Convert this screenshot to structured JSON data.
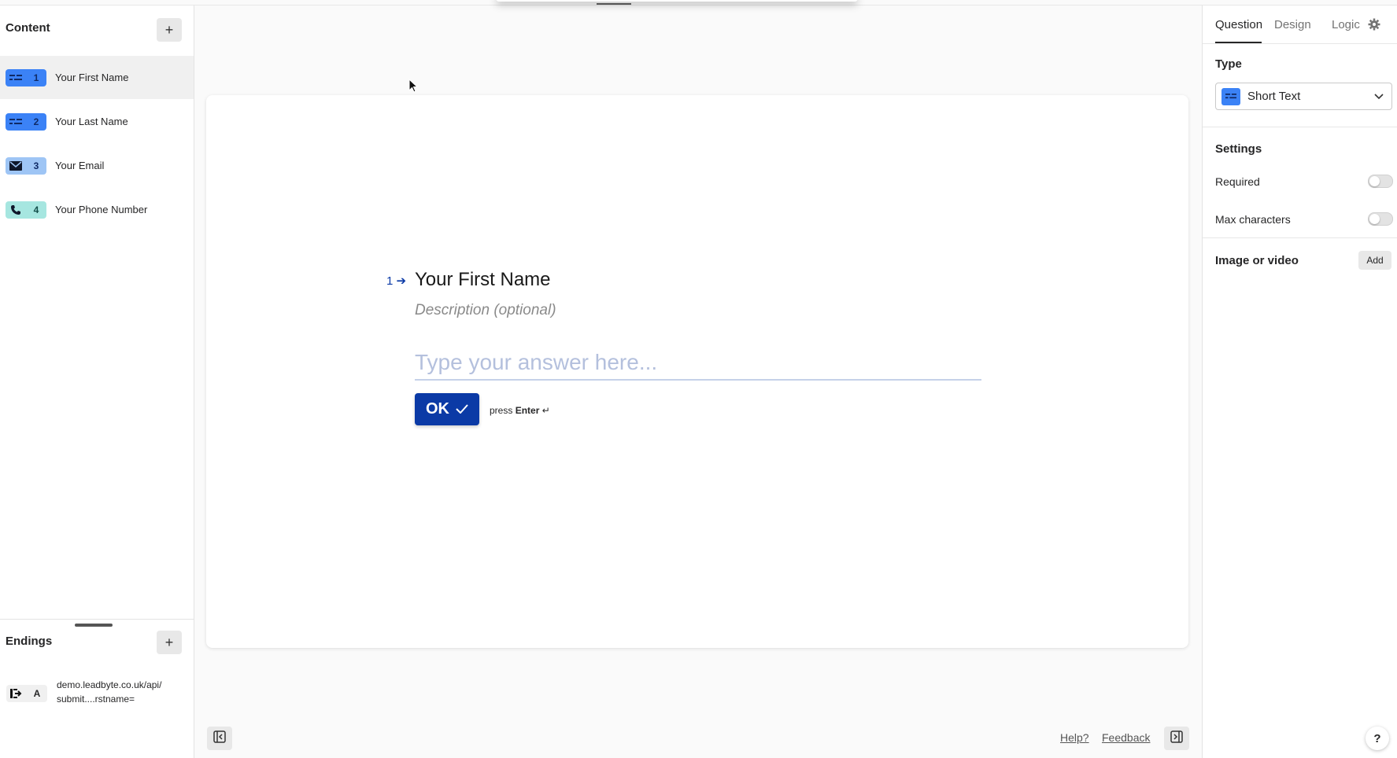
{
  "content": {
    "title": "Content",
    "add_label": "+",
    "questions": [
      {
        "num": "1",
        "label": "Your First Name",
        "icon": "short-text-icon",
        "color": "#3b82f6",
        "num_color": "#1e3a8a"
      },
      {
        "num": "2",
        "label": "Your Last Name",
        "icon": "short-text-icon",
        "color": "#3b82f6",
        "num_color": "#1e3a8a"
      },
      {
        "num": "3",
        "label": "Your Email",
        "icon": "mail-icon",
        "color": "#9ec5f5",
        "num_color": "#1e3a8a"
      },
      {
        "num": "4",
        "label": "Your Phone Number",
        "icon": "phone-icon",
        "color": "#a6e6e0",
        "num_color": "#134e4a"
      }
    ]
  },
  "endings": {
    "title": "Endings",
    "add_label": "+",
    "item": {
      "letter": "A",
      "text_line1": "demo.leadbyte.co.uk/api/",
      "text_line2": "submit....rstname="
    }
  },
  "preview": {
    "number": "1",
    "title": "Your First Name",
    "description": "Description (optional)",
    "answer_placeholder": "Type your answer here...",
    "ok_label": "OK",
    "press_label": "press",
    "enter_label": "Enter",
    "enter_symbol": "↵"
  },
  "footer": {
    "help": "Help?",
    "feedback": "Feedback"
  },
  "panel": {
    "tabs": [
      "Question",
      "Design",
      "Logic"
    ],
    "active_tab": "Question",
    "type_label": "Type",
    "type_value": "Short Text",
    "settings_label": "Settings",
    "required_label": "Required",
    "required_on": false,
    "max_chars_label": "Max characters",
    "max_chars_on": false,
    "media_label": "Image or video",
    "add_label": "Add",
    "help_button": "?"
  },
  "colors": {
    "accent": "#0b3aa6",
    "short_text": "#3b82f6"
  }
}
